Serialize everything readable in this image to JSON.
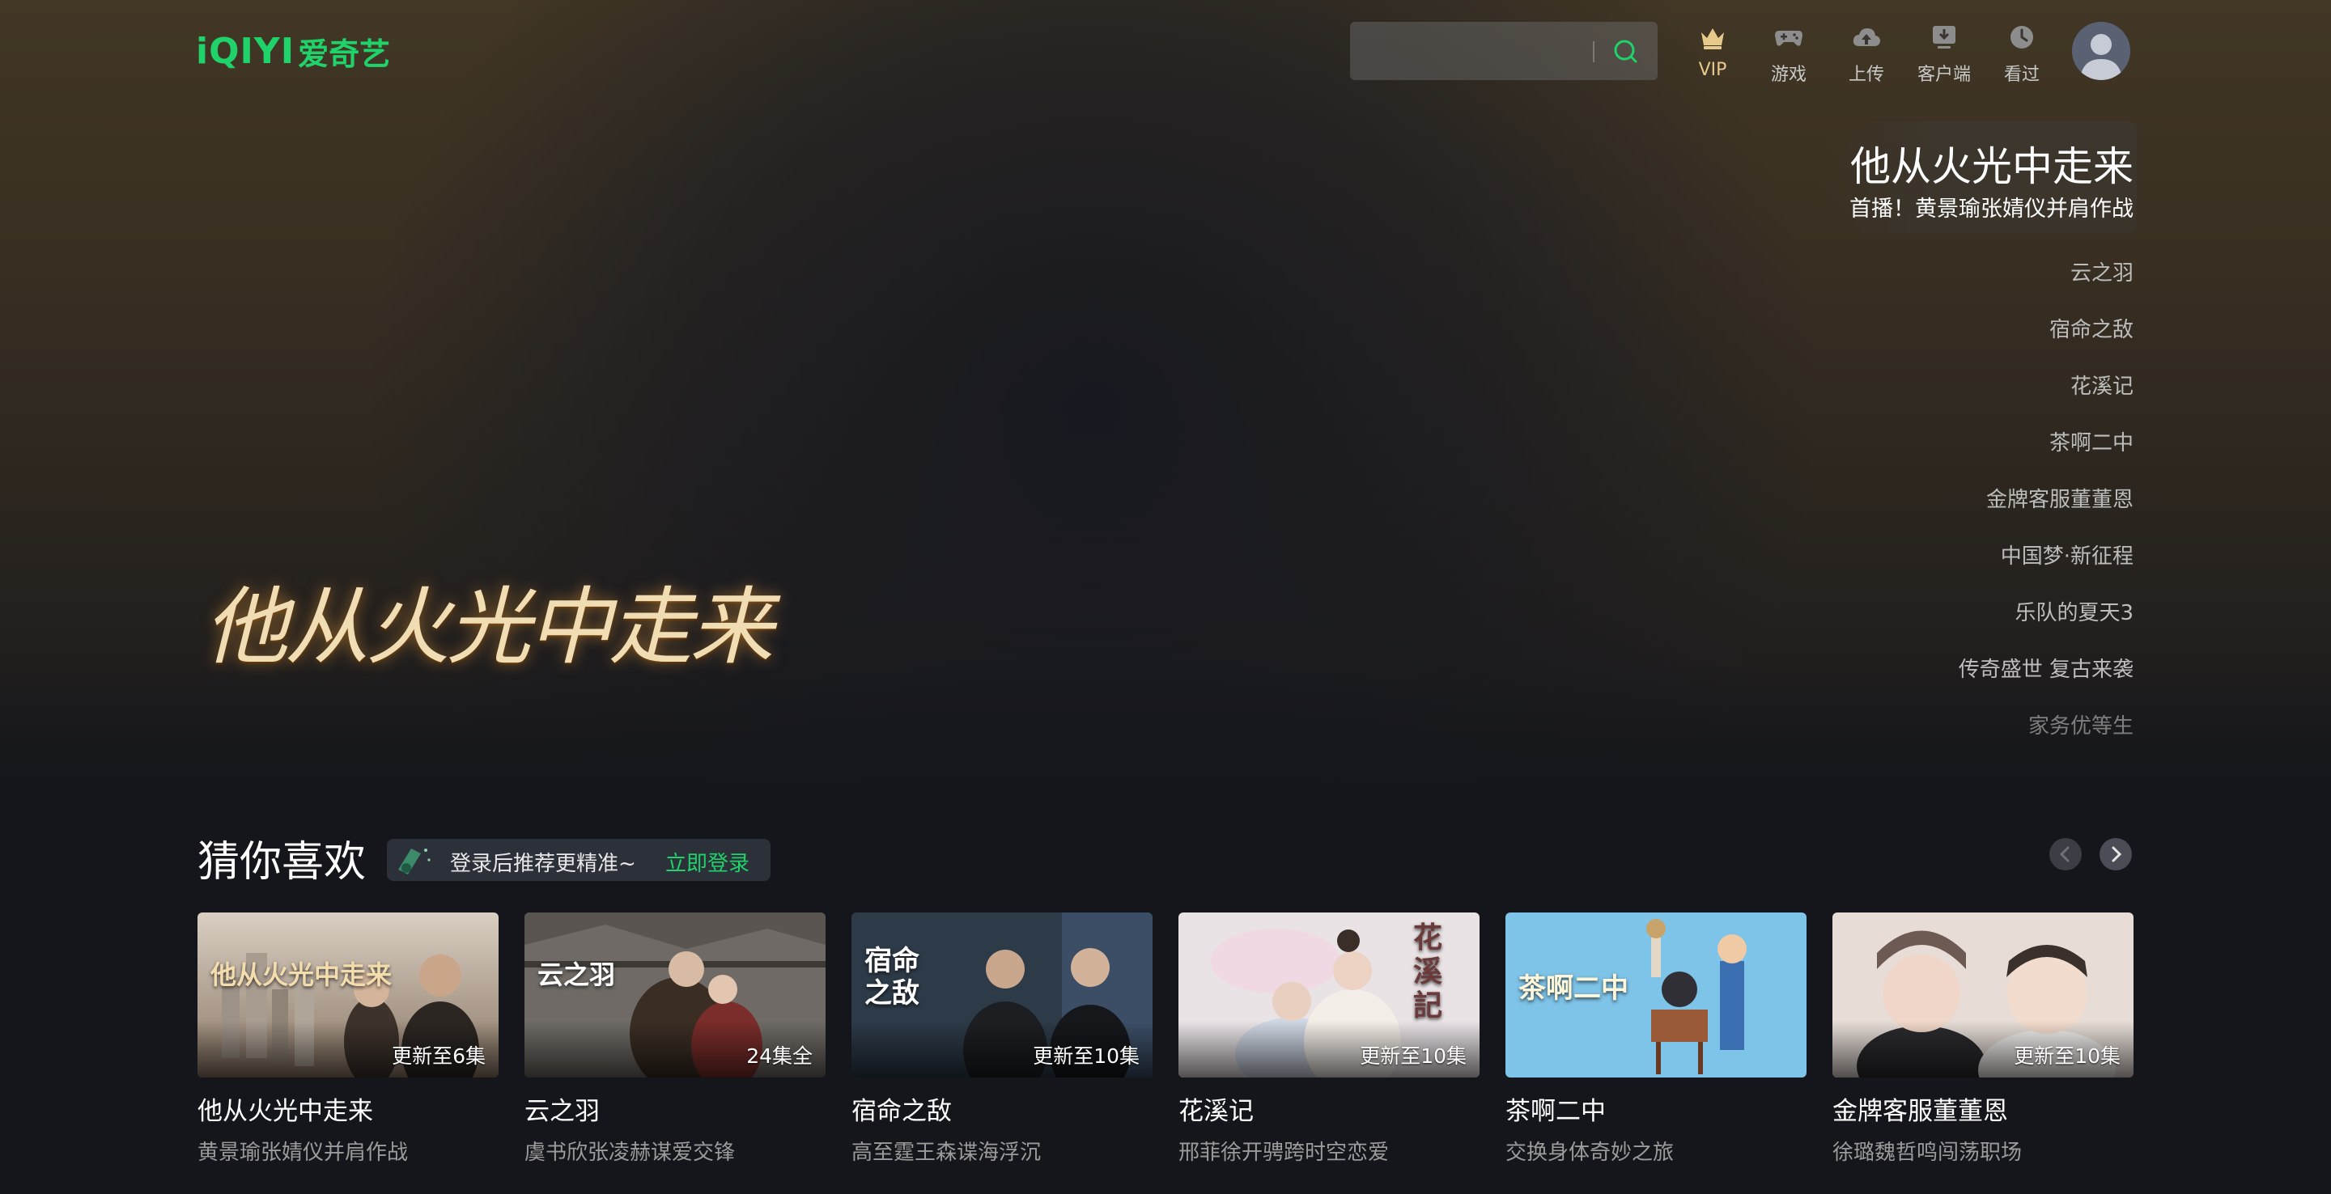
{
  "app": {
    "logo_en": "iQIYI",
    "logo_cn": "爱奇艺",
    "accent": "#1fd26a"
  },
  "search": {
    "placeholder": "",
    "icon": "search-icon"
  },
  "nav": [
    {
      "label": "VIP",
      "icon": "crown-icon"
    },
    {
      "label": "游戏",
      "icon": "gamepad-icon"
    },
    {
      "label": "上传",
      "icon": "cloud-upload-icon"
    },
    {
      "label": "客户端",
      "icon": "download-client-icon"
    },
    {
      "label": "看过",
      "icon": "history-clock-icon"
    }
  ],
  "hero": {
    "art_title": "他从火光中走来",
    "feature_title": "他从火光中走来",
    "feature_subtitle": "首播！黄景瑜张婧仪并肩作战",
    "list": [
      "云之羽",
      "宿命之敌",
      "花溪记",
      "茶啊二中",
      "金牌客服董董恩",
      "中国梦·新征程",
      "乐队的夏天3",
      "传奇盛世 复古来袭",
      "家务优等生"
    ]
  },
  "section": {
    "title": "猜你喜欢",
    "login_tip": "登录后推荐更精准~",
    "login_link": "立即登录"
  },
  "cards": [
    {
      "title": "他从火光中走来",
      "desc": "黄景瑜张婧仪并肩作战",
      "badge": "更新至6集",
      "art_text": "他从火光中走来"
    },
    {
      "title": "云之羽",
      "desc": "虞书欣张凌赫谋爱交锋",
      "badge": "24集全",
      "art_text": "云之羽"
    },
    {
      "title": "宿命之敌",
      "desc": "高至霆王森谍海浮沉",
      "badge": "更新至10集",
      "art_text": "宿命之敌"
    },
    {
      "title": "花溪记",
      "desc": "邢菲徐开骋跨时空恋爱",
      "badge": "更新至10集",
      "art_text": "花溪記"
    },
    {
      "title": "茶啊二中",
      "desc": "交换身体奇妙之旅",
      "badge": "",
      "art_text": "茶啊二中"
    },
    {
      "title": "金牌客服董董恩",
      "desc": "徐璐魏哲鸣闯荡职场",
      "badge": "更新至10集",
      "art_text": ""
    }
  ]
}
